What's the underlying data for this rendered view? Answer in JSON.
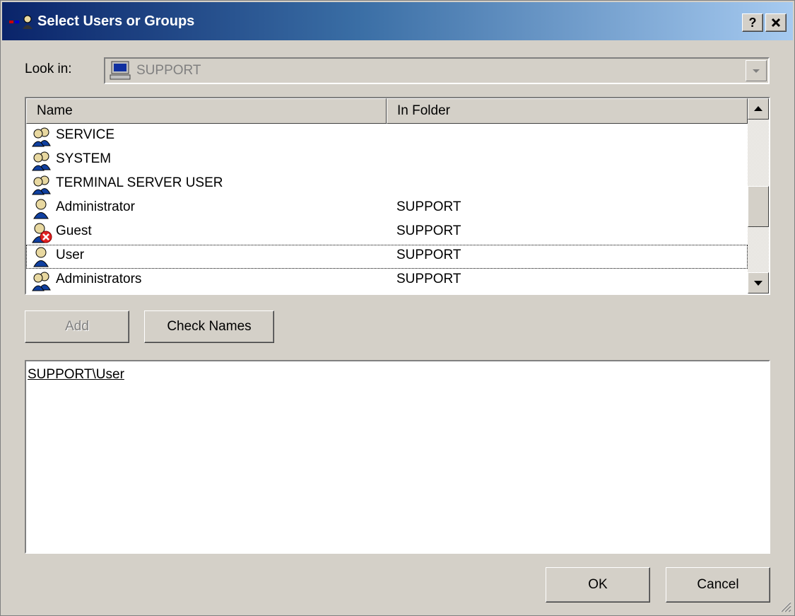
{
  "window": {
    "title": "Select Users or Groups",
    "help_glyph": "?",
    "close_glyph": "✕"
  },
  "lookin": {
    "label": "Look in:",
    "value": "SUPPORT"
  },
  "list": {
    "columns": [
      "Name",
      "In Folder"
    ],
    "rows": [
      {
        "name": "SERVICE",
        "folder": "",
        "icon": "group-icon"
      },
      {
        "name": "SYSTEM",
        "folder": "",
        "icon": "group-icon"
      },
      {
        "name": "TERMINAL SERVER USER",
        "folder": "",
        "icon": "group-icon"
      },
      {
        "name": "Administrator",
        "folder": "SUPPORT",
        "icon": "user-icon"
      },
      {
        "name": "Guest",
        "folder": "SUPPORT",
        "icon": "disabled-user-icon"
      },
      {
        "name": "User",
        "folder": "SUPPORT",
        "icon": "user-icon"
      },
      {
        "name": "Administrators",
        "folder": "SUPPORT",
        "icon": "group-icon"
      }
    ],
    "focused_row": "User"
  },
  "buttons": {
    "add": "Add",
    "check_names": "Check Names",
    "ok": "OK",
    "cancel": "Cancel"
  },
  "selected": {
    "entry": "SUPPORT\\User"
  },
  "colors": {
    "face": "#d4d0c8",
    "title_start": "#0a246a",
    "title_end": "#a6caf0"
  }
}
